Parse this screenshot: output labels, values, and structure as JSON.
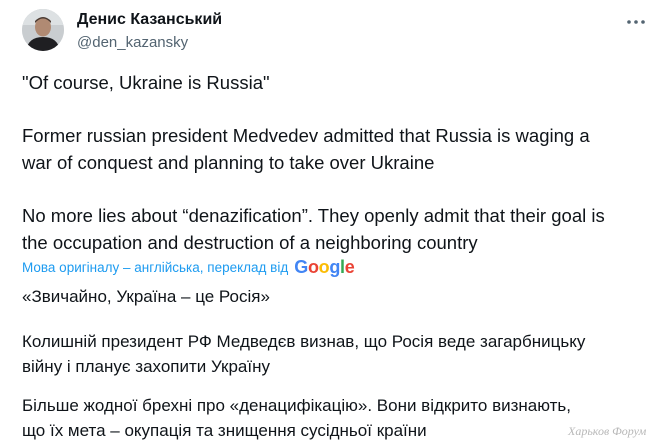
{
  "author": {
    "name": "Денис Казанський",
    "handle": "@den_kazansky"
  },
  "tweet": {
    "paragraphs": [
      "\"Of course, Ukraine is Russia\"",
      "Former russian president Medvedev admitted that Russia is waging a\nwar of conquest and planning to take over Ukraine",
      "No more lies about “denazification”. They openly admit that their goal is\nthe occupation and destruction of a neighboring country"
    ]
  },
  "translation": {
    "label": "Мова оригіналу – англійська, переклад від",
    "provider": "Google",
    "paragraphs": [
      "«Звичайно, Україна – це Росія»",
      "Колишній президент РФ Медведєв визнав, що Росія веде загарбницьку\nвійну і планує захопити Україну",
      "Більше жодної брехні про «денацифікацію». Вони відкрито визнають,\nщо їх мета – окупація та знищення сусідньої країни"
    ]
  },
  "watermark": "Харьков Форум",
  "colors": {
    "text": "#0f1419",
    "secondary": "#536471",
    "link": "#1d9bf0"
  },
  "icons": {
    "more": "more-horizontal-icon",
    "avatar": "avatar"
  }
}
